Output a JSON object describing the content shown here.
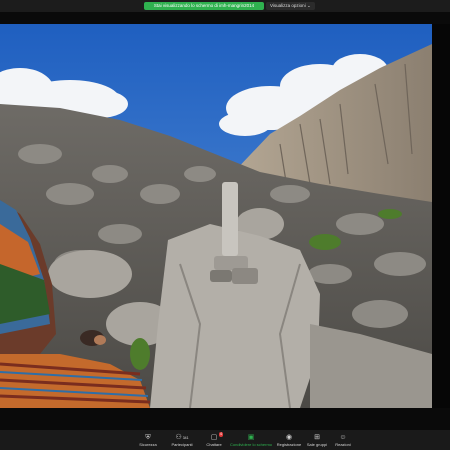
{
  "topbar": {
    "share_status": "Stai visualizzando lo schermo di imh-mangrin2014",
    "view_options": "Visualizza opzioni ⌄"
  },
  "video": {
    "description_colors": {
      "sky": "#2f6ec4",
      "cloud": "#f4f6f8",
      "rock": "#8c8a86",
      "shadow": "#3d3b37",
      "grass": "#4a7a2b"
    }
  },
  "toolbar": {
    "items": [
      {
        "label": "Sicurezza",
        "icon": "shield-icon"
      },
      {
        "label": "Partecipanti",
        "icon": "participants-icon",
        "count": "341"
      },
      {
        "label": "Chattare",
        "icon": "chat-icon",
        "badge": "4"
      },
      {
        "label": "Condividere lo schermo",
        "icon": "share-screen-icon"
      },
      {
        "label": "Registrazione",
        "icon": "record-icon"
      },
      {
        "label": "Sale gruppi",
        "icon": "breakout-rooms-icon"
      },
      {
        "label": "Reazioni",
        "icon": "reactions-icon"
      }
    ]
  },
  "colors": {
    "accent_green": "#2fb14f",
    "bar_bg": "#1a1a1a",
    "badge_red": "#e03a3a"
  }
}
